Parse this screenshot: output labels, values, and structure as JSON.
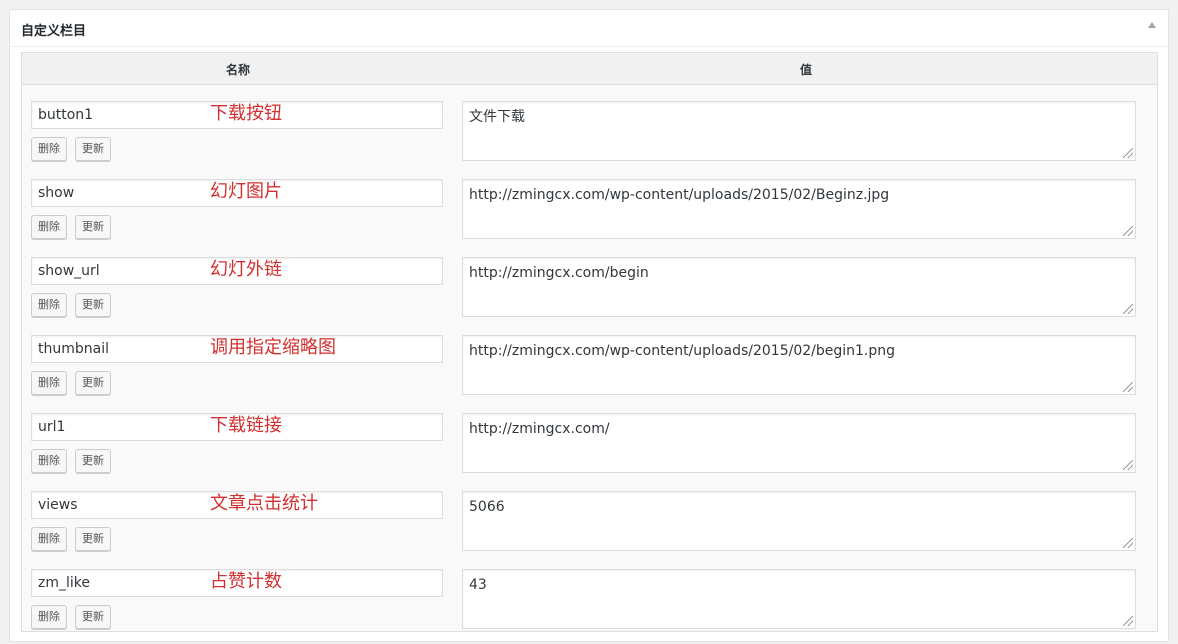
{
  "metabox": {
    "title": "自定义栏目",
    "toggle_icon": "triangle-up-icon"
  },
  "table": {
    "header_name": "名称",
    "header_value": "值"
  },
  "buttons": {
    "delete": "删除",
    "update": "更新"
  },
  "annotation_color": "#d23030",
  "rows": [
    {
      "key": "button1",
      "annotation": "下载按钮",
      "value": "文件下载"
    },
    {
      "key": "show",
      "annotation": "幻灯图片",
      "value": "http://zmingcx.com/wp-content/uploads/2015/02/Beginz.jpg"
    },
    {
      "key": "show_url",
      "annotation": "幻灯外链",
      "value": "http://zmingcx.com/begin"
    },
    {
      "key": "thumbnail",
      "annotation": "调用指定缩略图",
      "value": "http://zmingcx.com/wp-content/uploads/2015/02/begin1.png"
    },
    {
      "key": "url1",
      "annotation": "下载链接",
      "value": "http://zmingcx.com/"
    },
    {
      "key": "views",
      "annotation": "文章点击统计",
      "value": "5066"
    },
    {
      "key": "zm_like",
      "annotation": "占赞计数",
      "value": "43"
    }
  ]
}
